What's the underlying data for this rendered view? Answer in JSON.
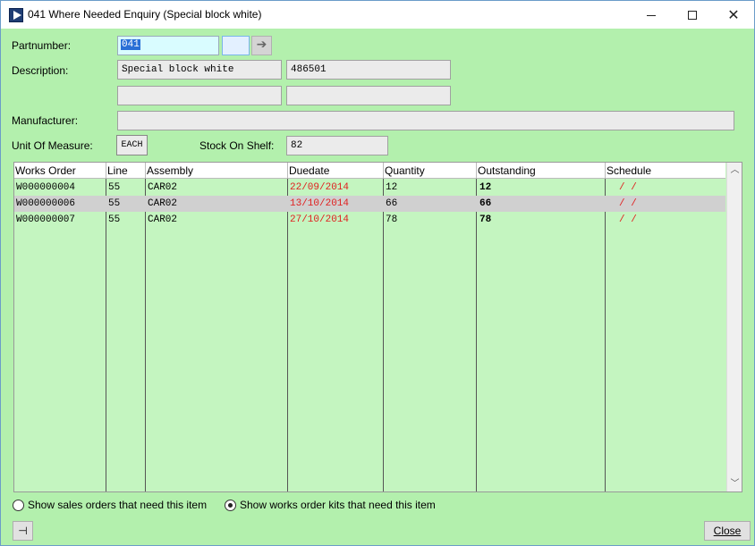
{
  "window": {
    "title": "041 Where Needed Enquiry (Special block white)"
  },
  "form": {
    "partnumber_label": "Partnumber:",
    "partnumber_value": "041",
    "description_label": "Description:",
    "description_1": "Special block white",
    "description_2": "486501",
    "description_3": "",
    "description_4": "",
    "manufacturer_label": "Manufacturer:",
    "manufacturer_value": "",
    "uom_label": "Unit Of Measure:",
    "uom_value": "EACH",
    "stock_label": "Stock On Shelf:",
    "stock_value": "82"
  },
  "table": {
    "columns": [
      "Works Order",
      "Line",
      "Assembly",
      "Duedate",
      "Quantity",
      "Outstanding",
      "Schedule"
    ],
    "rows": [
      {
        "works_order": "W000000004",
        "line": "55",
        "assembly": "CAR02",
        "duedate": "22/09/2014",
        "quantity": "12",
        "outstanding": "12",
        "schedule": "/  /",
        "selected": false
      },
      {
        "works_order": "W000000006",
        "line": "55",
        "assembly": "CAR02",
        "duedate": "13/10/2014",
        "quantity": "66",
        "outstanding": "66",
        "schedule": "/  /",
        "selected": true
      },
      {
        "works_order": "W000000007",
        "line": "55",
        "assembly": "CAR02",
        "duedate": "27/10/2014",
        "quantity": "78",
        "outstanding": "78",
        "schedule": "/  /",
        "selected": false
      }
    ]
  },
  "options": {
    "sales_orders_label": "Show sales orders that need this item",
    "sales_orders_checked": false,
    "works_order_kits_label": "Show works order kits that need this item",
    "works_order_kits_checked": true
  },
  "buttons": {
    "pin_glyph": "⊣",
    "close_label": "Close",
    "go_glyph": "➔"
  },
  "colors": {
    "background": "#b3f0ad",
    "grid_background": "#c4f5c0",
    "duedate_color": "#e02020",
    "selected_row": "#d0d0d0"
  }
}
